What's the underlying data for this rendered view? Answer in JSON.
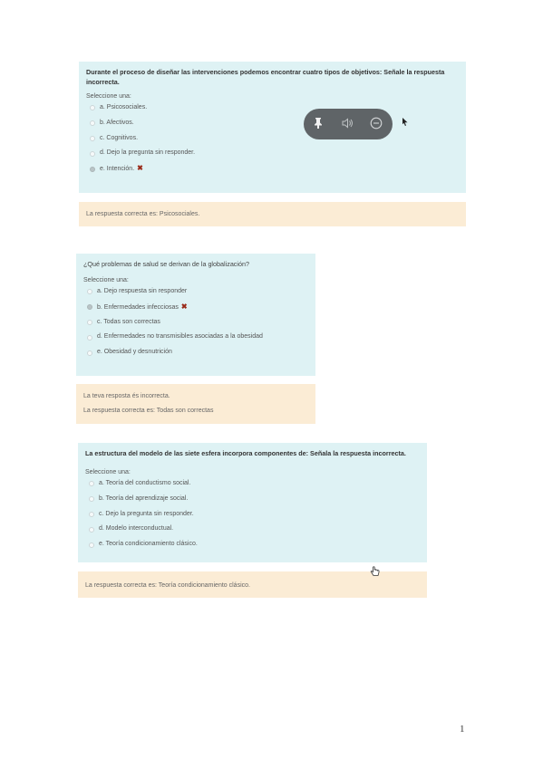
{
  "q1": {
    "text": "Durante el proceso de diseñar las intervenciones podemos encontrar cuatro tipos de objetivos: Señale la respuesta incorrecta.",
    "prompt": "Seleccione una:",
    "options": [
      "a. Psicosociales.",
      "b. Afectivos.",
      "c. Cognitivos.",
      "d. Dejo la pregunta sin responder.",
      "e. Intención."
    ],
    "selected_index": 4,
    "feedback": "La respuesta correcta es: Psicosociales."
  },
  "q2": {
    "text": "¿Qué problemas de salud se derivan de la globalización?",
    "prompt": "Seleccione una:",
    "options": [
      "a. Dejo respuesta sin responder",
      "b. Enfermedades infecciosas",
      "c. Todas son correctas",
      "d. Enfermedades no transmisibles asociadas a la obesidad",
      "e. Obesidad y desnutrición"
    ],
    "selected_index": 1,
    "feedback_1": "La teva resposta és incorrecta.",
    "feedback_2": "La respuesta correcta es: Todas son correctas"
  },
  "q3": {
    "text": "La estructura  del modelo de las siete esfera incorpora componentes de: Señala la respuesta incorrecta.",
    "prompt": "Seleccione una:",
    "options": [
      "a. Teoría del conductismo social.",
      "b. Teoría del aprendizaje social.",
      "c. Dejo la pregunta sin responder.",
      "d. Modelo interconductual.",
      "e. Teoría condicionamiento clásico."
    ],
    "selected_index": -1,
    "feedback": "La respuesta correcta es: Teoría condicionamiento clásico."
  },
  "wrong_mark": "✖",
  "icons": {
    "pin": "pin-icon",
    "volume": "volume-icon",
    "minus": "minus-circle-icon"
  },
  "page_number": "1"
}
